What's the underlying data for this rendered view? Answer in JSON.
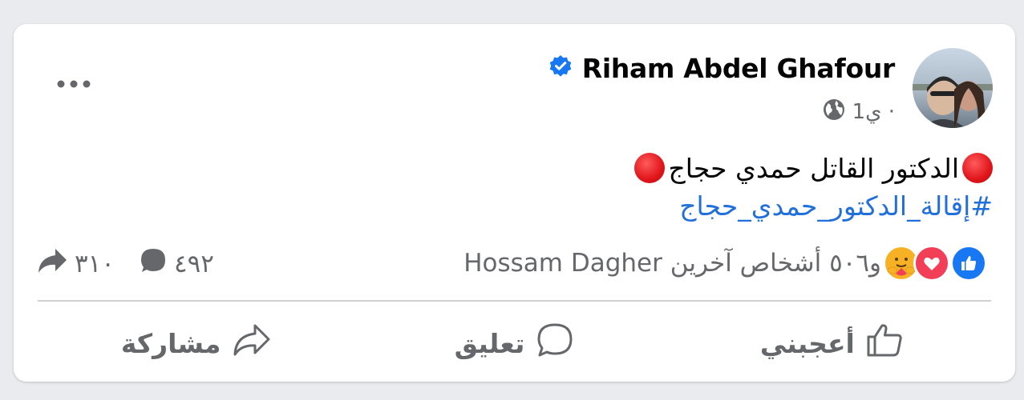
{
  "post": {
    "author": "Riham Abdel Ghafour",
    "verified": true,
    "time": "1ي ·",
    "privacy_icon": "globe-icon",
    "text": "الدكتور القاتل حمدي حجاج",
    "hashtag": "#إقالة_الدكتور_حمدي_حجاج"
  },
  "reactions": {
    "icons": [
      "like-icon",
      "love-icon",
      "care-icon"
    ],
    "summary": "Hossam Dagher و٥٠٦ أشخاص آخرين",
    "comments_count": "٤٩٢",
    "shares_count": "٣١٠"
  },
  "actions": {
    "like_label": "أعجبني",
    "comment_label": "تعليق",
    "share_label": "مشاركة"
  },
  "colors": {
    "background": "#e9ebee",
    "card": "#ffffff",
    "accent_blue": "#1877f2",
    "hashtag_blue": "#216fdb",
    "secondary_text": "#65676b",
    "stop_red": "#e0151b"
  }
}
